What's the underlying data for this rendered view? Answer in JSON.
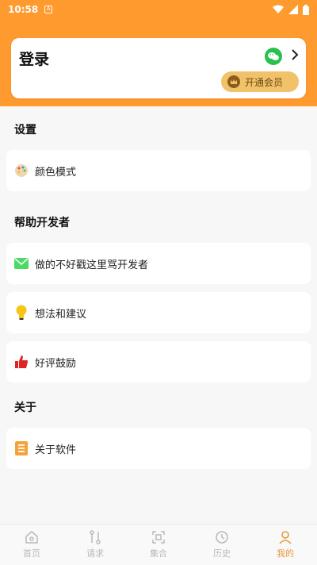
{
  "status_bar": {
    "time": "10:58",
    "app_badge": "A",
    "icons": [
      "wifi-icon",
      "signal-icon",
      "battery-icon"
    ]
  },
  "login": {
    "title": "登录",
    "vip_label": "开通会员",
    "icons": [
      "wechat-icon",
      "chevron-right-icon",
      "crown-icon"
    ]
  },
  "sections": {
    "settings": {
      "title": "设置",
      "items": [
        {
          "label": "颜色模式",
          "icon": "palette-icon"
        }
      ]
    },
    "help": {
      "title": "帮助开发者",
      "items": [
        {
          "label": "做的不好戳这里骂开发者",
          "icon": "mail-icon"
        },
        {
          "label": "想法和建议",
          "icon": "lightbulb-icon"
        },
        {
          "label": "好评鼓励",
          "icon": "thumbs-up-icon"
        }
      ]
    },
    "about": {
      "title": "关于",
      "items": [
        {
          "label": "关于软件",
          "icon": "document-icon"
        }
      ]
    }
  },
  "bottom_nav": {
    "items": [
      {
        "label": "首页",
        "icon": "home-icon"
      },
      {
        "label": "请求",
        "icon": "request-icon"
      },
      {
        "label": "集合",
        "icon": "collection-icon"
      },
      {
        "label": "历史",
        "icon": "clock-icon"
      },
      {
        "label": "我的",
        "icon": "user-icon"
      }
    ],
    "active_index": 4
  },
  "colors": {
    "brand": "#ff9a2e",
    "vip": "#f2c26a",
    "active_nav": "#e8983a",
    "inactive_nav": "#b9b9b9"
  }
}
